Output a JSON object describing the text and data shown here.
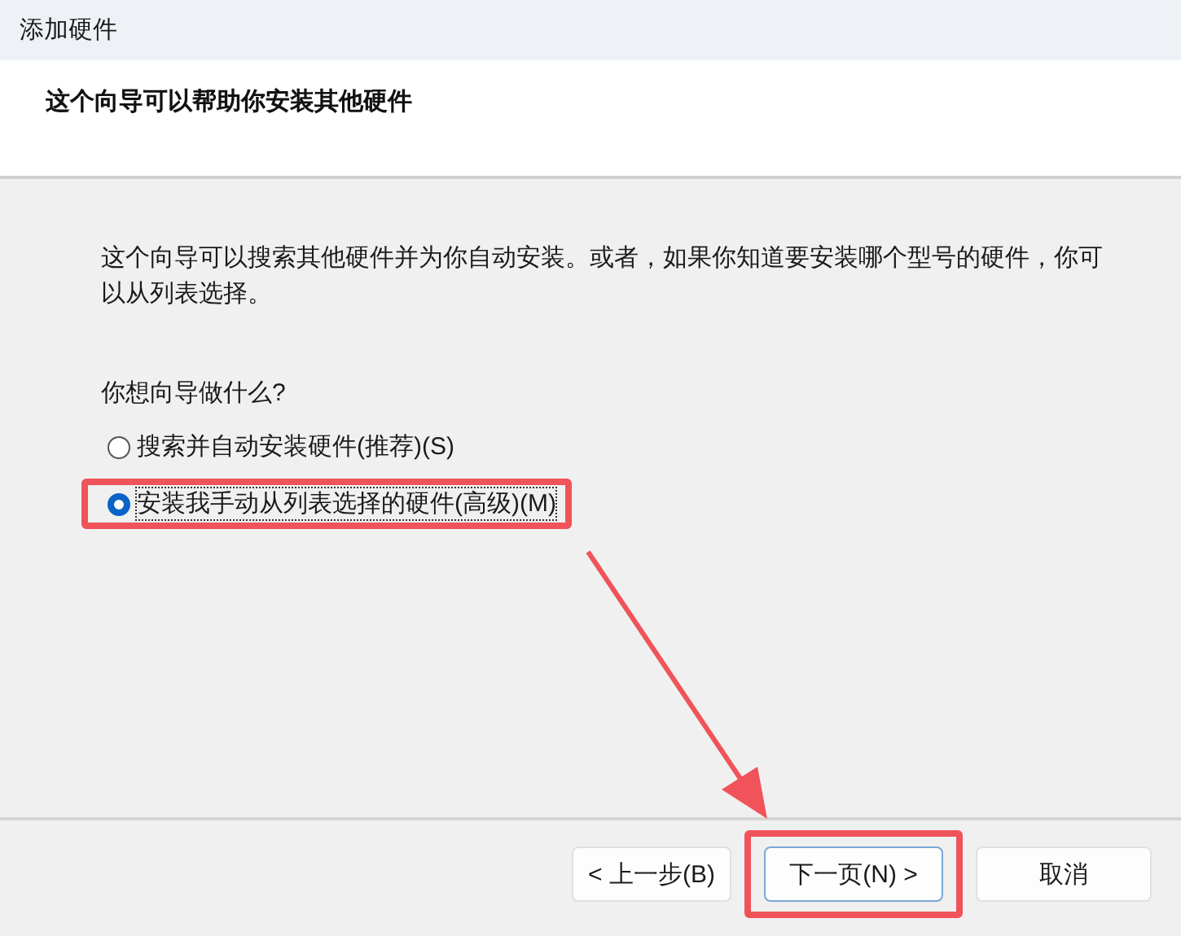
{
  "window": {
    "title": "添加硬件"
  },
  "header": {
    "title": "这个向导可以帮助你安装其他硬件"
  },
  "intro": "这个向导可以搜索其他硬件并为你自动安装。或者，如果你知道要安装哪个型号的硬件，你可以从列表选择。",
  "question": "你想向导做什么?",
  "options": [
    {
      "label": "搜索并自动安装硬件(推荐)(S)",
      "selected": false,
      "highlighted": false
    },
    {
      "label": "安装我手动从列表选择的硬件(高级)(M)",
      "selected": true,
      "highlighted": true
    }
  ],
  "buttons": [
    {
      "label": "< 上一步(B)",
      "highlighted": false,
      "default": false
    },
    {
      "label": "下一页(N) >",
      "highlighted": true,
      "default": true
    },
    {
      "label": "取消",
      "highlighted": false,
      "default": false
    }
  ]
}
